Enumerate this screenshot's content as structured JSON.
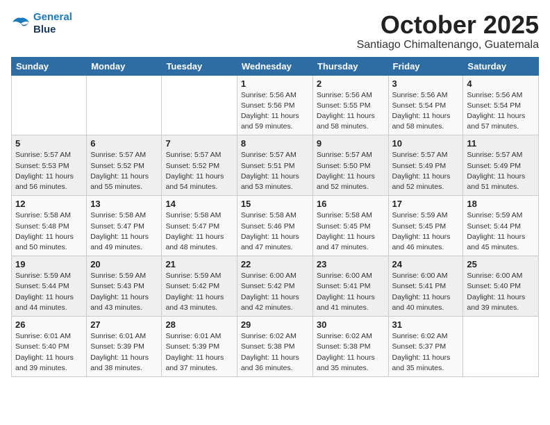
{
  "logo": {
    "line1": "General",
    "line2": "Blue"
  },
  "title": "October 2025",
  "location": "Santiago Chimaltenango, Guatemala",
  "weekdays": [
    "Sunday",
    "Monday",
    "Tuesday",
    "Wednesday",
    "Thursday",
    "Friday",
    "Saturday"
  ],
  "weeks": [
    [
      {
        "day": "",
        "info": ""
      },
      {
        "day": "",
        "info": ""
      },
      {
        "day": "",
        "info": ""
      },
      {
        "day": "1",
        "info": "Sunrise: 5:56 AM\nSunset: 5:56 PM\nDaylight: 11 hours\nand 59 minutes."
      },
      {
        "day": "2",
        "info": "Sunrise: 5:56 AM\nSunset: 5:55 PM\nDaylight: 11 hours\nand 58 minutes."
      },
      {
        "day": "3",
        "info": "Sunrise: 5:56 AM\nSunset: 5:54 PM\nDaylight: 11 hours\nand 58 minutes."
      },
      {
        "day": "4",
        "info": "Sunrise: 5:56 AM\nSunset: 5:54 PM\nDaylight: 11 hours\nand 57 minutes."
      }
    ],
    [
      {
        "day": "5",
        "info": "Sunrise: 5:57 AM\nSunset: 5:53 PM\nDaylight: 11 hours\nand 56 minutes."
      },
      {
        "day": "6",
        "info": "Sunrise: 5:57 AM\nSunset: 5:52 PM\nDaylight: 11 hours\nand 55 minutes."
      },
      {
        "day": "7",
        "info": "Sunrise: 5:57 AM\nSunset: 5:52 PM\nDaylight: 11 hours\nand 54 minutes."
      },
      {
        "day": "8",
        "info": "Sunrise: 5:57 AM\nSunset: 5:51 PM\nDaylight: 11 hours\nand 53 minutes."
      },
      {
        "day": "9",
        "info": "Sunrise: 5:57 AM\nSunset: 5:50 PM\nDaylight: 11 hours\nand 52 minutes."
      },
      {
        "day": "10",
        "info": "Sunrise: 5:57 AM\nSunset: 5:49 PM\nDaylight: 11 hours\nand 52 minutes."
      },
      {
        "day": "11",
        "info": "Sunrise: 5:57 AM\nSunset: 5:49 PM\nDaylight: 11 hours\nand 51 minutes."
      }
    ],
    [
      {
        "day": "12",
        "info": "Sunrise: 5:58 AM\nSunset: 5:48 PM\nDaylight: 11 hours\nand 50 minutes."
      },
      {
        "day": "13",
        "info": "Sunrise: 5:58 AM\nSunset: 5:47 PM\nDaylight: 11 hours\nand 49 minutes."
      },
      {
        "day": "14",
        "info": "Sunrise: 5:58 AM\nSunset: 5:47 PM\nDaylight: 11 hours\nand 48 minutes."
      },
      {
        "day": "15",
        "info": "Sunrise: 5:58 AM\nSunset: 5:46 PM\nDaylight: 11 hours\nand 47 minutes."
      },
      {
        "day": "16",
        "info": "Sunrise: 5:58 AM\nSunset: 5:45 PM\nDaylight: 11 hours\nand 47 minutes."
      },
      {
        "day": "17",
        "info": "Sunrise: 5:59 AM\nSunset: 5:45 PM\nDaylight: 11 hours\nand 46 minutes."
      },
      {
        "day": "18",
        "info": "Sunrise: 5:59 AM\nSunset: 5:44 PM\nDaylight: 11 hours\nand 45 minutes."
      }
    ],
    [
      {
        "day": "19",
        "info": "Sunrise: 5:59 AM\nSunset: 5:44 PM\nDaylight: 11 hours\nand 44 minutes."
      },
      {
        "day": "20",
        "info": "Sunrise: 5:59 AM\nSunset: 5:43 PM\nDaylight: 11 hours\nand 43 minutes."
      },
      {
        "day": "21",
        "info": "Sunrise: 5:59 AM\nSunset: 5:42 PM\nDaylight: 11 hours\nand 43 minutes."
      },
      {
        "day": "22",
        "info": "Sunrise: 6:00 AM\nSunset: 5:42 PM\nDaylight: 11 hours\nand 42 minutes."
      },
      {
        "day": "23",
        "info": "Sunrise: 6:00 AM\nSunset: 5:41 PM\nDaylight: 11 hours\nand 41 minutes."
      },
      {
        "day": "24",
        "info": "Sunrise: 6:00 AM\nSunset: 5:41 PM\nDaylight: 11 hours\nand 40 minutes."
      },
      {
        "day": "25",
        "info": "Sunrise: 6:00 AM\nSunset: 5:40 PM\nDaylight: 11 hours\nand 39 minutes."
      }
    ],
    [
      {
        "day": "26",
        "info": "Sunrise: 6:01 AM\nSunset: 5:40 PM\nDaylight: 11 hours\nand 39 minutes."
      },
      {
        "day": "27",
        "info": "Sunrise: 6:01 AM\nSunset: 5:39 PM\nDaylight: 11 hours\nand 38 minutes."
      },
      {
        "day": "28",
        "info": "Sunrise: 6:01 AM\nSunset: 5:39 PM\nDaylight: 11 hours\nand 37 minutes."
      },
      {
        "day": "29",
        "info": "Sunrise: 6:02 AM\nSunset: 5:38 PM\nDaylight: 11 hours\nand 36 minutes."
      },
      {
        "day": "30",
        "info": "Sunrise: 6:02 AM\nSunset: 5:38 PM\nDaylight: 11 hours\nand 35 minutes."
      },
      {
        "day": "31",
        "info": "Sunrise: 6:02 AM\nSunset: 5:37 PM\nDaylight: 11 hours\nand 35 minutes."
      },
      {
        "day": "",
        "info": ""
      }
    ]
  ]
}
